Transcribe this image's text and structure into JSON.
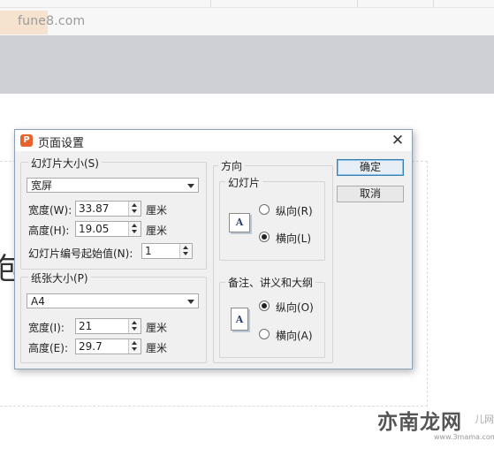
{
  "background": {
    "watermark_top": "fune8.com",
    "slide_char": "包",
    "watermark_logo": "亦南龙网",
    "watermark_url": "www.3mama.com",
    "watermark_partial": "儿网"
  },
  "dialog": {
    "title": "页面设置",
    "icon": "wps-presentation-icon",
    "close_label": "✕",
    "slide_size": {
      "legend": "幻灯片大小(S)",
      "preset": "宽屏",
      "width_label": "宽度(W):",
      "width_value": "33.87",
      "width_unit": "厘米",
      "height_label": "高度(H):",
      "height_value": "19.05",
      "height_unit": "厘米",
      "start_label": "幻灯片编号起始值(N):",
      "start_value": "1"
    },
    "paper_size": {
      "legend": "纸张大小(P)",
      "preset": "A4",
      "width_label": "宽度(I):",
      "width_value": "21",
      "width_unit": "厘米",
      "height_label": "高度(E):",
      "height_value": "29.7",
      "height_unit": "厘米"
    },
    "orientation": {
      "legend": "方向",
      "slides": {
        "legend": "幻灯片",
        "portrait_label": "纵向(R)",
        "landscape_label": "横向(L)",
        "selected": "landscape",
        "icon_letter": "A"
      },
      "notes": {
        "legend": "备注、讲义和大纲",
        "portrait_label": "纵向(O)",
        "landscape_label": "横向(A)",
        "selected": "portrait",
        "icon_letter": "A"
      }
    },
    "ok_label": "确定",
    "cancel_label": "取消"
  }
}
